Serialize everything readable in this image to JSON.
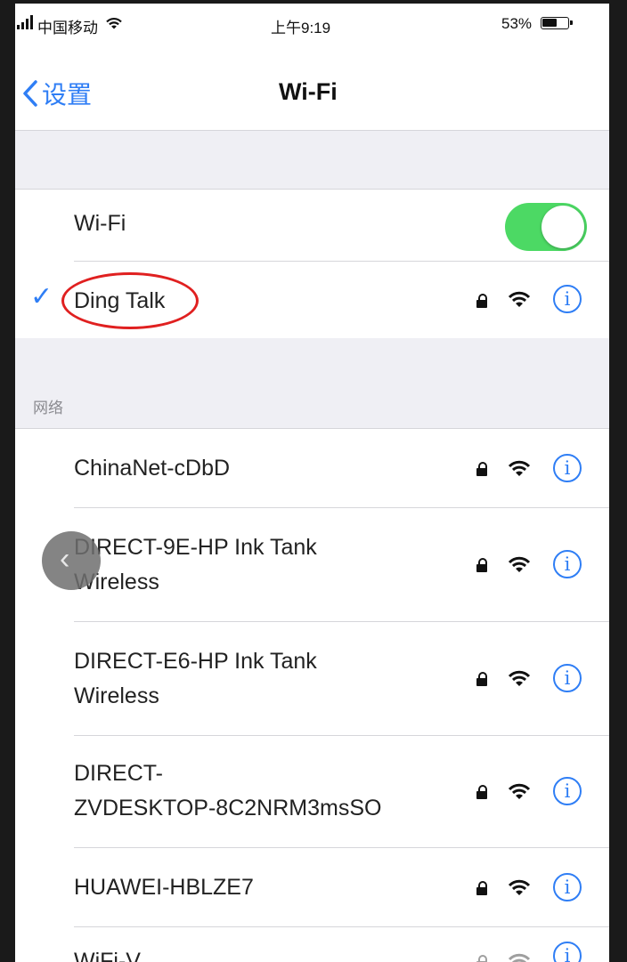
{
  "status_bar": {
    "carrier": "中国移动",
    "time": "上午9:19",
    "battery": "53%"
  },
  "nav": {
    "back_label": "设置",
    "title": "Wi-Fi"
  },
  "wifi_toggle": {
    "label": "Wi-Fi",
    "on": true
  },
  "connected": {
    "name": "Ding Talk",
    "highlight_color": "#e02020"
  },
  "networks_section": {
    "header": "网络",
    "items": [
      {
        "line1": "ChinaNet-cDbD",
        "line2": ""
      },
      {
        "line1": "DIRECT-9E-HP Ink Tank",
        "line2": "Wireless"
      },
      {
        "line1": "DIRECT-E6-HP Ink Tank",
        "line2": "Wireless"
      },
      {
        "line1": "DIRECT-",
        "line2": "ZVDESKTOP-8C2NRM3msSO"
      },
      {
        "line1": "HUAWEI-HBLZE7",
        "line2": ""
      },
      {
        "line1": "WiFi-V",
        "line2": ""
      }
    ]
  },
  "colors": {
    "accent": "#2f7ef5",
    "toggle_on": "#4cd964",
    "group_bg": "#efeff4"
  },
  "icons": {
    "info": "i",
    "checkmark": "✓",
    "back_chevron": "chevron-left",
    "float_back": "‹"
  }
}
